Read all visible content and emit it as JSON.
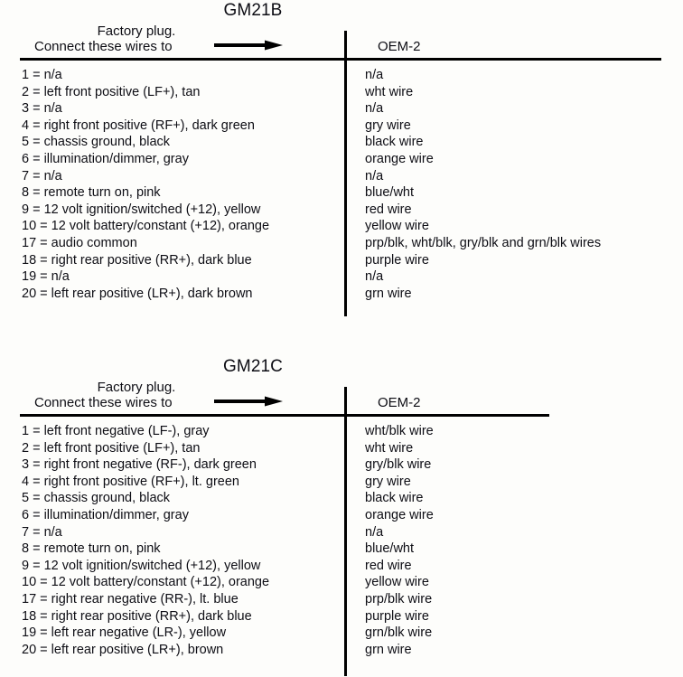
{
  "page": {
    "background_color": "#fdfdfb",
    "text_color": "#0d0d14"
  },
  "tables": [
    {
      "id": "gm21b",
      "title": "GM21B",
      "factory_plug_line1": "Factory plug.",
      "factory_plug_line2": "Connect these wires to",
      "arrow_icon": "right-arrow-icon",
      "oem_header": "OEM-2",
      "rows": [
        {
          "left": "1 = n/a",
          "right": "n/a"
        },
        {
          "left": "2 = left front positive (LF+), tan",
          "right": "wht wire"
        },
        {
          "left": "3 = n/a",
          "right": "n/a"
        },
        {
          "left": "4 = right front positive (RF+), dark green",
          "right": "gry wire"
        },
        {
          "left": "5 = chassis ground, black",
          "right": "black wire"
        },
        {
          "left": "6 = illumination/dimmer, gray",
          "right": "orange wire"
        },
        {
          "left": "7 = n/a",
          "right": "n/a"
        },
        {
          "left": "8 = remote turn on, pink",
          "right": "blue/wht"
        },
        {
          "left": "9 = 12 volt ignition/switched (+12), yellow",
          "right": "red wire"
        },
        {
          "left": "10 = 12 volt battery/constant (+12), orange",
          "right": "yellow wire"
        },
        {
          "left": "17 = audio common",
          "right": "prp/blk, wht/blk, gry/blk and grn/blk wires"
        },
        {
          "left": "18 = right rear positive (RR+), dark blue",
          "right": "purple wire"
        },
        {
          "left": "19 = n/a",
          "right": "n/a"
        },
        {
          "left": "20 = left rear positive (LR+), dark brown",
          "right": "grn wire"
        }
      ]
    },
    {
      "id": "gm21c",
      "title": "GM21C",
      "factory_plug_line1": "Factory plug.",
      "factory_plug_line2": "Connect these wires to",
      "arrow_icon": "right-arrow-icon",
      "oem_header": "OEM-2",
      "rows": [
        {
          "left": "1 = left front negative (LF-), gray",
          "right": "wht/blk wire"
        },
        {
          "left": "2 = left front positive (LF+), tan",
          "right": "wht wire"
        },
        {
          "left": "3 = right front negative (RF-), dark green",
          "right": "gry/blk wire"
        },
        {
          "left": "4 = right front positive (RF+), lt. green",
          "right": "gry wire"
        },
        {
          "left": "5 = chassis ground, black",
          "right": "black wire"
        },
        {
          "left": "6 = illumination/dimmer, gray",
          "right": "orange wire"
        },
        {
          "left": "7 = n/a",
          "right": "n/a"
        },
        {
          "left": "8 = remote turn on, pink",
          "right": "blue/wht"
        },
        {
          "left": "9 = 12 volt ignition/switched (+12), yellow",
          "right": "red wire"
        },
        {
          "left": "10 = 12 volt battery/constant (+12), orange",
          "right": "yellow wire"
        },
        {
          "left": "17 = right rear negative (RR-), lt. blue",
          "right": "prp/blk wire"
        },
        {
          "left": "18 = right rear positive (RR+), dark blue",
          "right": "purple wire"
        },
        {
          "left": "19 = left rear negative (LR-), yellow",
          "right": "grn/blk wire"
        },
        {
          "left": "20 = left rear positive (LR+), brown",
          "right": "grn wire"
        }
      ]
    }
  ]
}
